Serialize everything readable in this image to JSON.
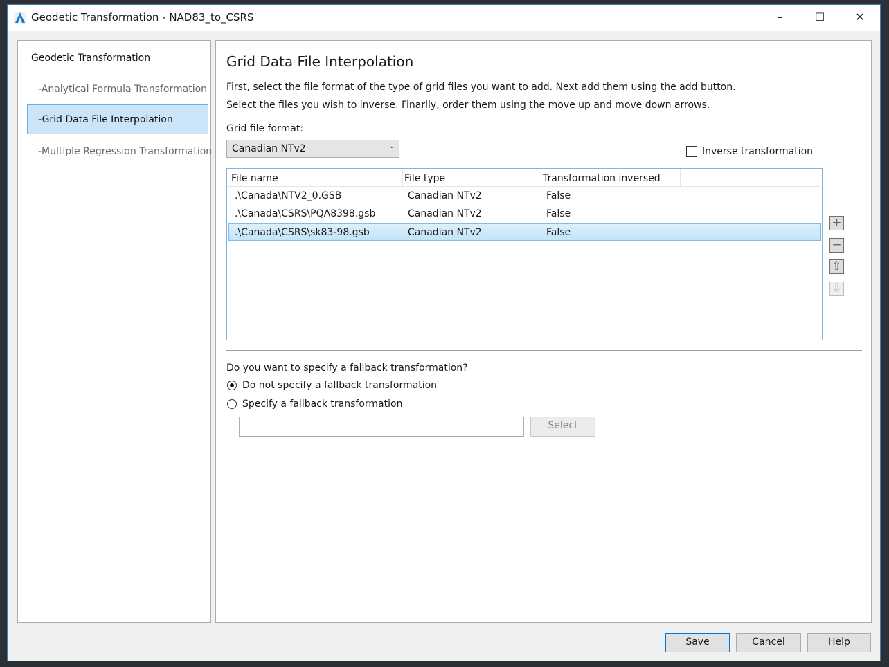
{
  "window": {
    "title": "Geodetic Transformation - NAD83_to_CSRS",
    "minimize": "–",
    "maximize": "☐",
    "close": "✕"
  },
  "sidebar": {
    "heading": "Geodetic Transformation",
    "items": [
      {
        "label": "-Analytical Formula Transformation"
      },
      {
        "label": "-Grid Data File Interpolation",
        "selected": true
      },
      {
        "label": "-Multiple Regression Transformation"
      }
    ]
  },
  "main": {
    "title": "Grid Data File Interpolation",
    "instructions": [
      "First, select the file format of the type of grid files you want to add. Next add them using the add button.",
      "Select the files you wish to inverse. Finarlly, order them using the move up and move down arrows."
    ],
    "format_label": "Grid file format:",
    "format_value": "Canadian NTv2",
    "inverse_label": "Inverse transformation",
    "inverse_checked": false,
    "table": {
      "columns": [
        "File name",
        "File type",
        "Transformation inversed"
      ],
      "rows": [
        {
          "file": ".\\Canada\\NTV2_0.GSB",
          "type": "Canadian NTv2",
          "inversed": "False"
        },
        {
          "file": ".\\Canada\\CSRS\\PQA8398.gsb",
          "type": "Canadian NTv2",
          "inversed": "False"
        },
        {
          "file": ".\\Canada\\CSRS\\sk83-98.gsb",
          "type": "Canadian NTv2",
          "inversed": "False",
          "selected": true
        }
      ]
    },
    "side_buttons": {
      "add": "+",
      "remove": "−",
      "up": "⇧",
      "down": "⇩"
    },
    "fallback_question": "Do you want to specify a fallback transformation?",
    "fallback_options": [
      {
        "label": "Do not specify a fallback transformation",
        "checked": true
      },
      {
        "label": "Specify a fallback transformation",
        "checked": false
      }
    ],
    "fallback_value": "",
    "select_label": "Select"
  },
  "footer": {
    "save": "Save",
    "cancel": "Cancel",
    "help": "Help"
  },
  "colors": {
    "selection": "#cce4f7",
    "accent": "#0078d7"
  }
}
